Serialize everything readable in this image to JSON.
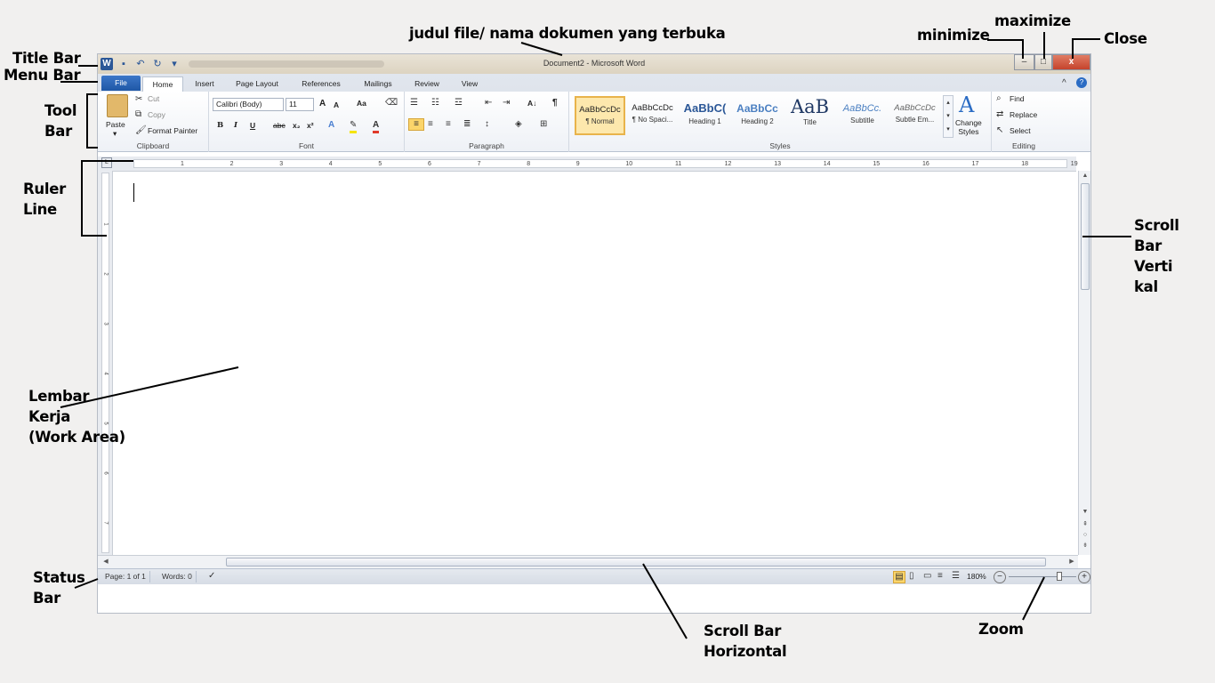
{
  "annotations": {
    "title_bar": "Title Bar",
    "menu_bar": "Menu Bar",
    "tool_bar": [
      "Tool",
      "Bar"
    ],
    "ruler_line": [
      "Ruler",
      "Line"
    ],
    "work_area": [
      "Lembar",
      "Kerja",
      "(Work Area)"
    ],
    "status_bar": [
      "Status",
      "Bar"
    ],
    "file_name": "judul file/ nama dokumen yang terbuka",
    "minimize": "minimize",
    "maximize": "maximize",
    "close": "Close",
    "scroll_vertical": [
      "Scroll",
      "Bar",
      "Verti",
      "kal"
    ],
    "scroll_horizontal": [
      "Scroll Bar",
      "Horizontal"
    ],
    "zoom": "Zoom"
  },
  "window": {
    "title": "Document2 - Microsoft Word",
    "app_icon": "W",
    "controls": {
      "minimize": "–",
      "maximize": "□",
      "close": "x"
    }
  },
  "quick_access": [
    "save-icon",
    "undo-icon",
    "redo-icon",
    "customize-icon"
  ],
  "tabs": [
    "File",
    "Home",
    "Insert",
    "Page Layout",
    "References",
    "Mailings",
    "Review",
    "View"
  ],
  "active_tab": "Home",
  "clipboard": {
    "paste": "Paste",
    "cut": "Cut",
    "copy": "Copy",
    "format_painter": "Format Painter",
    "label": "Clipboard"
  },
  "font": {
    "name": "Calibri (Body)",
    "size": "11",
    "grow": "A",
    "shrink": "A",
    "change_case": "Aa",
    "bold": "B",
    "italic": "I",
    "underline": "U",
    "strike": "abc",
    "subscript": "x₂",
    "superscript": "x²",
    "label": "Font"
  },
  "paragraph": {
    "label": "Paragraph",
    "show_marks": "¶",
    "sort": "A↓"
  },
  "styles": {
    "label": "Styles",
    "items": [
      {
        "sample": "AaBbCcDc",
        "name": "¶ Normal"
      },
      {
        "sample": "AaBbCcDc",
        "name": "¶ No Spaci..."
      },
      {
        "sample": "AaBbC(",
        "name": "Heading 1"
      },
      {
        "sample": "AaBbCc",
        "name": "Heading 2"
      },
      {
        "sample": "AaB",
        "name": "Title"
      },
      {
        "sample": "AaBbCc.",
        "name": "Subtitle"
      },
      {
        "sample": "AaBbCcDc",
        "name": "Subtle Em..."
      }
    ],
    "change_styles": [
      "Change",
      "Styles"
    ]
  },
  "editing": {
    "find": "Find",
    "replace": "Replace",
    "select": "Select",
    "label": "Editing"
  },
  "ruler_numbers": [
    "1",
    "2",
    "3",
    "4",
    "5",
    "6",
    "7",
    "8",
    "9",
    "10",
    "11",
    "12",
    "13",
    "14",
    "15",
    "16",
    "17",
    "18",
    "19"
  ],
  "vruler_numbers": [
    "1",
    "2",
    "3",
    "4",
    "5",
    "6",
    "7"
  ],
  "status": {
    "page": "Page: 1 of 1",
    "words": "Words: 0",
    "zoom": "180%",
    "zoom_level": 0.75
  }
}
